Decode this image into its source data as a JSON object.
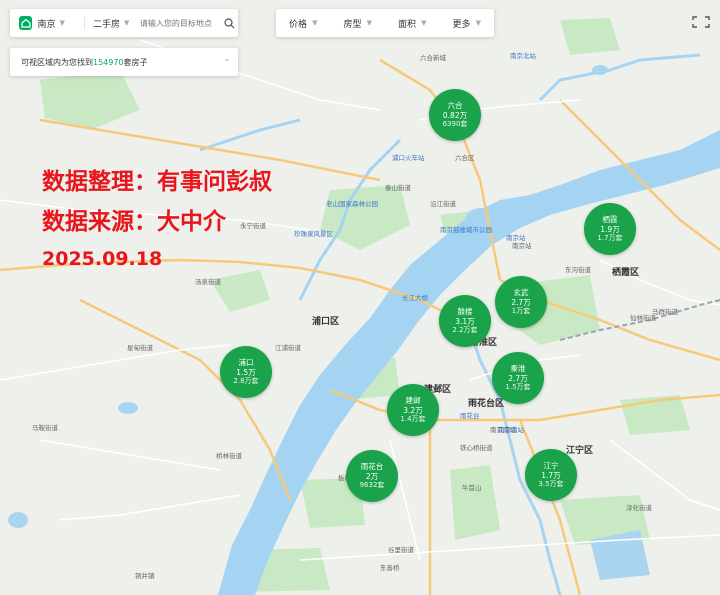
{
  "search_bar": {
    "city": "南京",
    "listing_type": "二手房",
    "placeholder": "请输入您的目标地点"
  },
  "filters": [
    "价格",
    "房型",
    "面积",
    "更多"
  ],
  "result_summary": {
    "prefix": "可视区域内为您找到",
    "count": "154970",
    "suffix": "套房子"
  },
  "watermark": {
    "line1": "数据整理：有事问彭叔",
    "line2": "数据来源：大中介",
    "line3": "2025.09.18"
  },
  "districts": [
    {
      "name": "六合",
      "price": "0.82万",
      "count": "6390套"
    },
    {
      "name": "栖霞",
      "price": "1.9万",
      "count": "1.7万套"
    },
    {
      "name": "玄武",
      "price": "2.7万",
      "count": "1万套"
    },
    {
      "name": "鼓楼",
      "price": "3.1万",
      "count": "2.2万套"
    },
    {
      "name": "秦淮",
      "price": "2.7万",
      "count": "1.5万套"
    },
    {
      "name": "浦口",
      "price": "1.5万",
      "count": "2.8万套"
    },
    {
      "name": "建邺",
      "price": "3.2万",
      "count": "1.4万套"
    },
    {
      "name": "雨花台",
      "price": "2万",
      "count": "9632套"
    },
    {
      "name": "江宁",
      "price": "1.7万",
      "count": "3.5万套"
    }
  ],
  "map_labels": {
    "areas": [
      "浦口区",
      "建邺区",
      "雨花台区",
      "栖霞区",
      "秦淮区",
      "江宁区"
    ],
    "places": [
      "六合新城",
      "沿江街道",
      "泰山街道",
      "汤泉街道",
      "永宁街道",
      "星甸街道",
      "桥林街道",
      "铜井镇",
      "江浦街道",
      "六合区",
      "马鞍街道",
      "仙林街道",
      "东沟街道",
      "南京南站",
      "铁心桥街道",
      "牛首山",
      "东善桥",
      "谷里街道",
      "板桥街道",
      "南京站",
      "马群街道",
      "淳化街道"
    ],
    "pois": [
      "浦口火车站",
      "南京北站",
      "南京南站",
      "南京站",
      "雨花台",
      "南京鼓楼城市公园",
      "珍珠泉风景区",
      "老山国家森林公园",
      "长江大桥"
    ]
  },
  "colors": {
    "accent": "#00ae66",
    "bubble": "#1aa34a",
    "watermark": "#e8161c",
    "river": "#a5d4f3",
    "green": "#c5e8c1"
  }
}
